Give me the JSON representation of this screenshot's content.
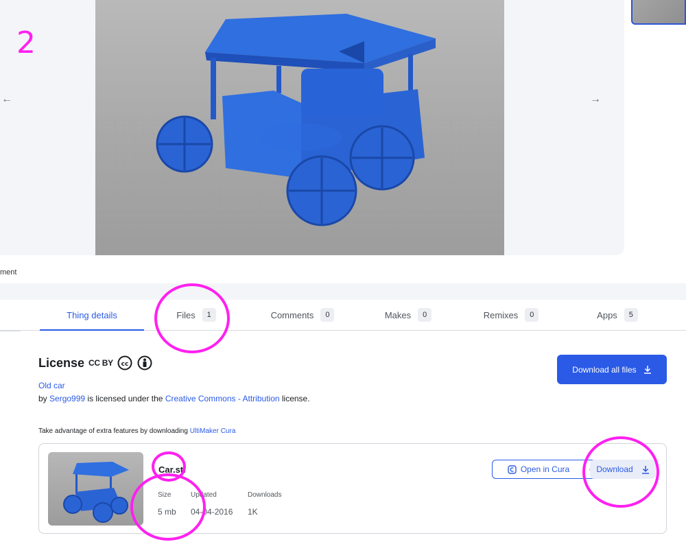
{
  "annotation": {
    "step_number": "2"
  },
  "gallery": {
    "prev_arrow": "←",
    "next_arrow": "→",
    "caption": "ment"
  },
  "tabs": [
    {
      "label": "Thing details",
      "count": ""
    },
    {
      "label": "Files",
      "count": "1"
    },
    {
      "label": "Comments",
      "count": "0"
    },
    {
      "label": "Makes",
      "count": "0"
    },
    {
      "label": "Remixes",
      "count": "0"
    },
    {
      "label": "Apps",
      "count": "5"
    }
  ],
  "license": {
    "title": "License",
    "type": "CC BY",
    "thing_name": "Old car",
    "by": "by ",
    "author": "Sergo999",
    "middle": " is licensed under the ",
    "license_name": "Creative Commons - Attribution",
    "end": " license."
  },
  "download_all": {
    "label": "Download all files"
  },
  "cura_note": {
    "text": "Take advantage of extra features by downloading ",
    "link": "UltiMaker Cura"
  },
  "file": {
    "name": "Car.stl",
    "size_label": "Size",
    "size": "5 mb",
    "updated_label": "Updated",
    "updated": "04-04-2016",
    "downloads_label": "Downloads",
    "downloads": "1K",
    "open_in_cura": "Open in Cura",
    "more": "···",
    "download": "Download"
  },
  "colors": {
    "accent": "#2a5ae6",
    "annotation": "#ff20f0",
    "model_blue": "#2f6fe0"
  }
}
